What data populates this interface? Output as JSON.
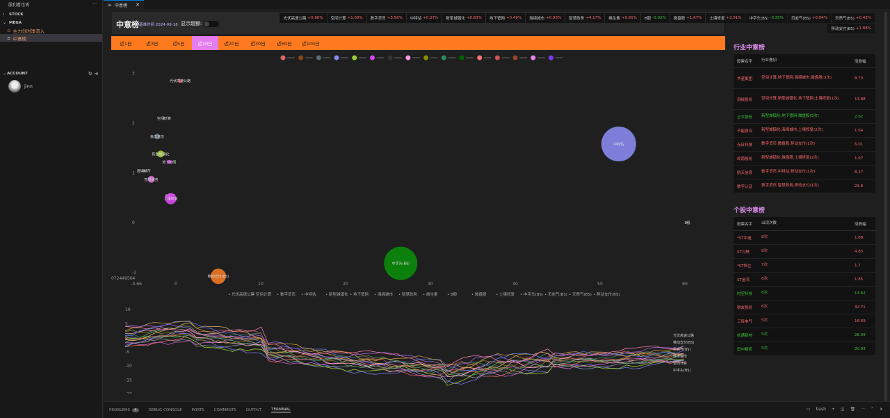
{
  "sidebar": {
    "header": "股利看也诱",
    "more": "···",
    "stock": "STOCK",
    "mega": "MEGA",
    "items": [
      {
        "label": "主力分时净流入",
        "icon": "⊙"
      },
      {
        "label": "中意榜",
        "icon": "≡"
      }
    ],
    "account": "ACCOUNT",
    "user": "jinn"
  },
  "tab": {
    "label": "中意榜",
    "close": "✕"
  },
  "header": {
    "title": "中意榜",
    "date": "基准时间 2024-06-18",
    "switch_label": "显示超额:"
  },
  "ticker": [
    {
      "name": "光伏高速公路",
      "val": "+0.86%",
      "dir": "up"
    },
    {
      "name": "空间计算",
      "val": "+1.69%",
      "dir": "up"
    },
    {
      "name": "数字货币",
      "val": "+3.56%",
      "dir": "up"
    },
    {
      "name": "中特估",
      "val": "+0.27%",
      "dir": "up"
    },
    {
      "name": "新型城镇化",
      "val": "+0.83%",
      "dir": "up"
    },
    {
      "name": "地下管网",
      "val": "+0.49%",
      "dir": "up"
    },
    {
      "name": "海绵城市",
      "val": "+0.93%",
      "dir": "up"
    },
    {
      "name": "智慧政务",
      "val": "+4.17%",
      "dir": "up"
    },
    {
      "name": "维生素",
      "val": "+0.91%",
      "dir": "up"
    },
    {
      "name": "B股",
      "val": "-0.02%",
      "dir": "dn"
    },
    {
      "name": "微盘股",
      "val": "+1.67%",
      "dir": "up"
    },
    {
      "name": "土壤修复",
      "val": "+2.01%",
      "dir": "up"
    },
    {
      "name": "中字头(BS)",
      "val": "-0.35%",
      "dir": "dn"
    },
    {
      "name": "页岩气(BS)",
      "val": "+0.94%",
      "dir": "up"
    },
    {
      "name": "天然气(BS)",
      "val": "+0.42%",
      "dir": "up"
    },
    {
      "name": "移动支付(BS)",
      "val": "+1.88%",
      "dir": "up"
    }
  ],
  "periods": [
    {
      "label": "近1日",
      "active": false
    },
    {
      "label": "近3日",
      "active": false
    },
    {
      "label": "近5日",
      "active": false
    },
    {
      "label": "近10日",
      "active": true
    },
    {
      "label": "近20日",
      "active": false
    },
    {
      "label": "近30日",
      "active": false
    },
    {
      "label": "近60日",
      "active": false
    },
    {
      "label": "近100日",
      "active": false
    }
  ],
  "industry": {
    "title": "行业中意榜",
    "headers": [
      "股票名字",
      "行业叠加",
      "涨跌幅"
    ],
    "rows": [
      {
        "name": "华蓝集团",
        "tags": "空间计算,地下管网,海绵城市,微盘股(3次)",
        "chg": "8.73",
        "dir": "up"
      },
      {
        "name": "测绘股份",
        "tags": "空间计算,新型城镇化,地下管网,土壤修复(1次)",
        "chg": "13.88",
        "dir": "up"
      },
      {
        "name": "正平股份",
        "tags": "新型城镇化,地下管网,微盘股(3次)",
        "chg": "2.62",
        "dir": "dn"
      },
      {
        "name": "节能铁汉",
        "tags": "新型城镇化,海绵城市,土壤修复(2次)",
        "chg": "1.64",
        "dir": "up"
      },
      {
        "name": "光日科技",
        "tags": "数字货币,微盘股,移动支付(1次)",
        "chg": "6.01",
        "dir": "up"
      },
      {
        "name": "岭南股份",
        "tags": "新型城镇化,微盘股,土壤修复(2次)",
        "chg": "1.07",
        "dir": "up"
      },
      {
        "name": "航天信息",
        "tags": "数字货币,中特估,移动支付(1次)",
        "chg": "8.17",
        "dir": "up"
      },
      {
        "name": "数字认证",
        "tags": "数字货币,智慧政务,移动支付(1次)",
        "chg": "23.8",
        "dir": "up"
      }
    ]
  },
  "stocks": {
    "title": "个股中意榜",
    "headers": [
      "股票名字",
      "出现次数",
      "涨跌幅"
    ],
    "rows": [
      {
        "name": "*ST中迪",
        "cnt": "8次",
        "chg": "1.88",
        "dir": "up"
      },
      {
        "name": "ST万林",
        "cnt": "8次",
        "chg": "4.85",
        "dir": "up"
      },
      {
        "name": "*ST恒立",
        "cnt": "7次",
        "chg": "1.7",
        "dir": "up"
      },
      {
        "name": "ST金鸿",
        "cnt": "6次",
        "chg": "1.85",
        "dir": "up"
      },
      {
        "name": "时空科技",
        "cnt": "6次",
        "chg": "13.62",
        "dir": "dn"
      },
      {
        "name": "税友股份",
        "cnt": "6次",
        "chg": "32.71",
        "dir": "up"
      },
      {
        "name": "三晖电气",
        "cnt": "5次",
        "chg": "16.69",
        "dir": "up"
      },
      {
        "name": "屹通新材",
        "cnt": "5次",
        "chg": "26.09",
        "dir": "dn"
      },
      {
        "name": "田中精机",
        "cnt": "5次",
        "chg": "20.93",
        "dir": "dn"
      }
    ]
  },
  "chart_data": [
    {
      "type": "scatter",
      "x_ticks": [
        "-4.66",
        "0",
        "10",
        "20",
        "30",
        "40",
        "50",
        "60"
      ],
      "y_ticks": [
        "3",
        "2",
        "1",
        "0",
        "-1"
      ],
      "x_corner_label": "072449564",
      "legend_colors": [
        "#e06666",
        "#8b4513",
        "#5a6a7a",
        "#8888ee",
        "#9acd32",
        "#d946ef",
        "#333",
        "#ff99dd",
        "#8b8b00",
        "#2e8b57",
        "#006400",
        "#ff7777",
        "#cc5555",
        "#994422",
        "#ee82ee",
        "#7c3aed"
      ],
      "bubbles": [
        {
          "label": "光伏高速公路",
          "x": 0.5,
          "y": 2.85,
          "r": 3,
          "color": "#cc4444"
        },
        {
          "label": "空间计算",
          "x": -1.4,
          "y": 2.1,
          "r": 2,
          "color": "#888"
        },
        {
          "label": "数字货币",
          "x": -2.2,
          "y": 1.73,
          "r": 4,
          "color": "#6b7c8f"
        },
        {
          "label": "新型城镇化",
          "x": -1.8,
          "y": 1.38,
          "r": 5,
          "color": "#9acd32"
        },
        {
          "label": "地下管网",
          "x": -0.8,
          "y": 1.22,
          "r": 3,
          "color": "#d946ef"
        },
        {
          "label": "海绵城市",
          "x": -3.8,
          "y": 1.04,
          "r": 2,
          "color": "#888"
        },
        {
          "label": "智慧政务",
          "x": -2.9,
          "y": 0.87,
          "r": 5,
          "color": "#cc66cc"
        },
        {
          "label": "维生素",
          "x": -0.7,
          "y": 0.54,
          "r": 3,
          "color": "#c9a"
        },
        {
          "label": "土壤修复",
          "x": -0.6,
          "y": 0.48,
          "r": 8,
          "color": "#d946ef"
        },
        {
          "label": "中特估",
          "x": 52.2,
          "y": 1.58,
          "r": 25,
          "color": "#8888ee"
        },
        {
          "label": "中字头(BS)",
          "x": 26.5,
          "y": -0.82,
          "r": 24,
          "color": "#0a8a0a"
        },
        {
          "label": "移动支付(BS)",
          "x": 5,
          "y": -1.08,
          "r": 11,
          "color": "#ee7722"
        },
        {
          "label": "B股",
          "x": 60.3,
          "y": 0,
          "r": 1,
          "color": "#888"
        }
      ],
      "series_legend": [
        "光伏高速公路",
        "空间计算",
        "数字货币",
        "中特估",
        "新型城镇化",
        "地下管网",
        "海绵城市",
        "智慧政务",
        "维生素",
        "B股",
        "微盘股",
        "土壤修复",
        "中字头(BS)",
        "页岩气(BS)",
        "天然气(BS)",
        "移动支付(BS)"
      ]
    },
    {
      "type": "line",
      "y_ticks": [
        "10",
        "5",
        "0",
        "-5",
        "-10",
        "-15",
        "-20"
      ],
      "end_labels": [
        "光伏高速公路",
        "移动支付(BS)",
        "页岩气(BS)",
        "数字货币",
        "空间计算",
        "中字头(BS)"
      ]
    }
  ],
  "statusbar": {
    "items": [
      "PROBLEMS",
      "DEBUG CONSOLE",
      "PORTS",
      "COMMENTS",
      "OUTPUT",
      "TERMINAL"
    ],
    "problems_count": "4",
    "shell": "bash"
  }
}
